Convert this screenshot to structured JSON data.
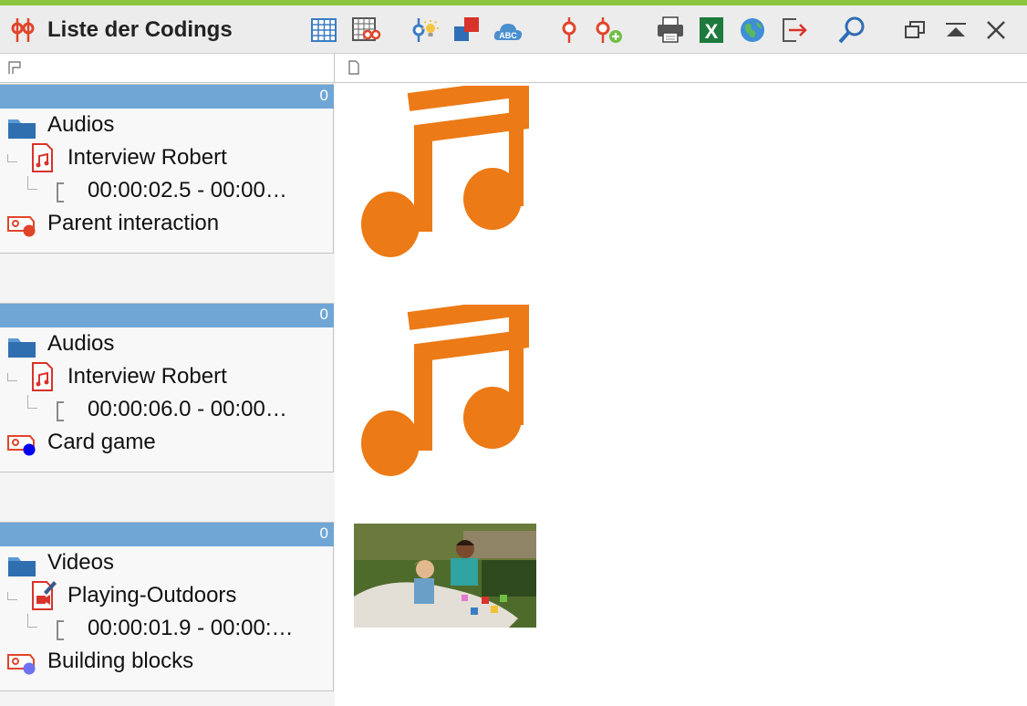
{
  "window": {
    "title": "Liste der Codings",
    "accent_color": "#8cc63f"
  },
  "toolbar": {
    "icons": [
      "table-icon",
      "table-codes-icon",
      "code-highlight-icon",
      "color-squares-icon",
      "abc-cloud-icon",
      "code-icon",
      "add-code-icon",
      "print-icon",
      "excel-icon",
      "web-export-icon",
      "export-icon",
      "search-icon",
      "restore-window-icon",
      "collapse-icon",
      "close-icon"
    ]
  },
  "columns": {
    "left_icon": "flag-icon",
    "right_icon": "document-icon"
  },
  "codings": [
    {
      "count": "0",
      "folder": "Audios",
      "document": "Interview Robert",
      "doc_type": "audio",
      "segment": "00:00:02.5 - 00:00…",
      "code": "Parent interaction",
      "code_color": "#e0452a",
      "preview": "music-note-icon"
    },
    {
      "count": "0",
      "folder": "Audios",
      "document": "Interview Robert",
      "doc_type": "audio",
      "segment": "00:00:06.0 - 00:00…",
      "code": "Card game",
      "code_color": "#0000ee",
      "preview": "music-note-icon"
    },
    {
      "count": "0",
      "folder": "Videos",
      "document": "Playing-Outdoors",
      "doc_type": "video",
      "segment": "00:00:01.9 - 00:00:…",
      "code": "Building blocks",
      "code_color": "#6e72f0",
      "preview": "video-thumbnail"
    }
  ]
}
